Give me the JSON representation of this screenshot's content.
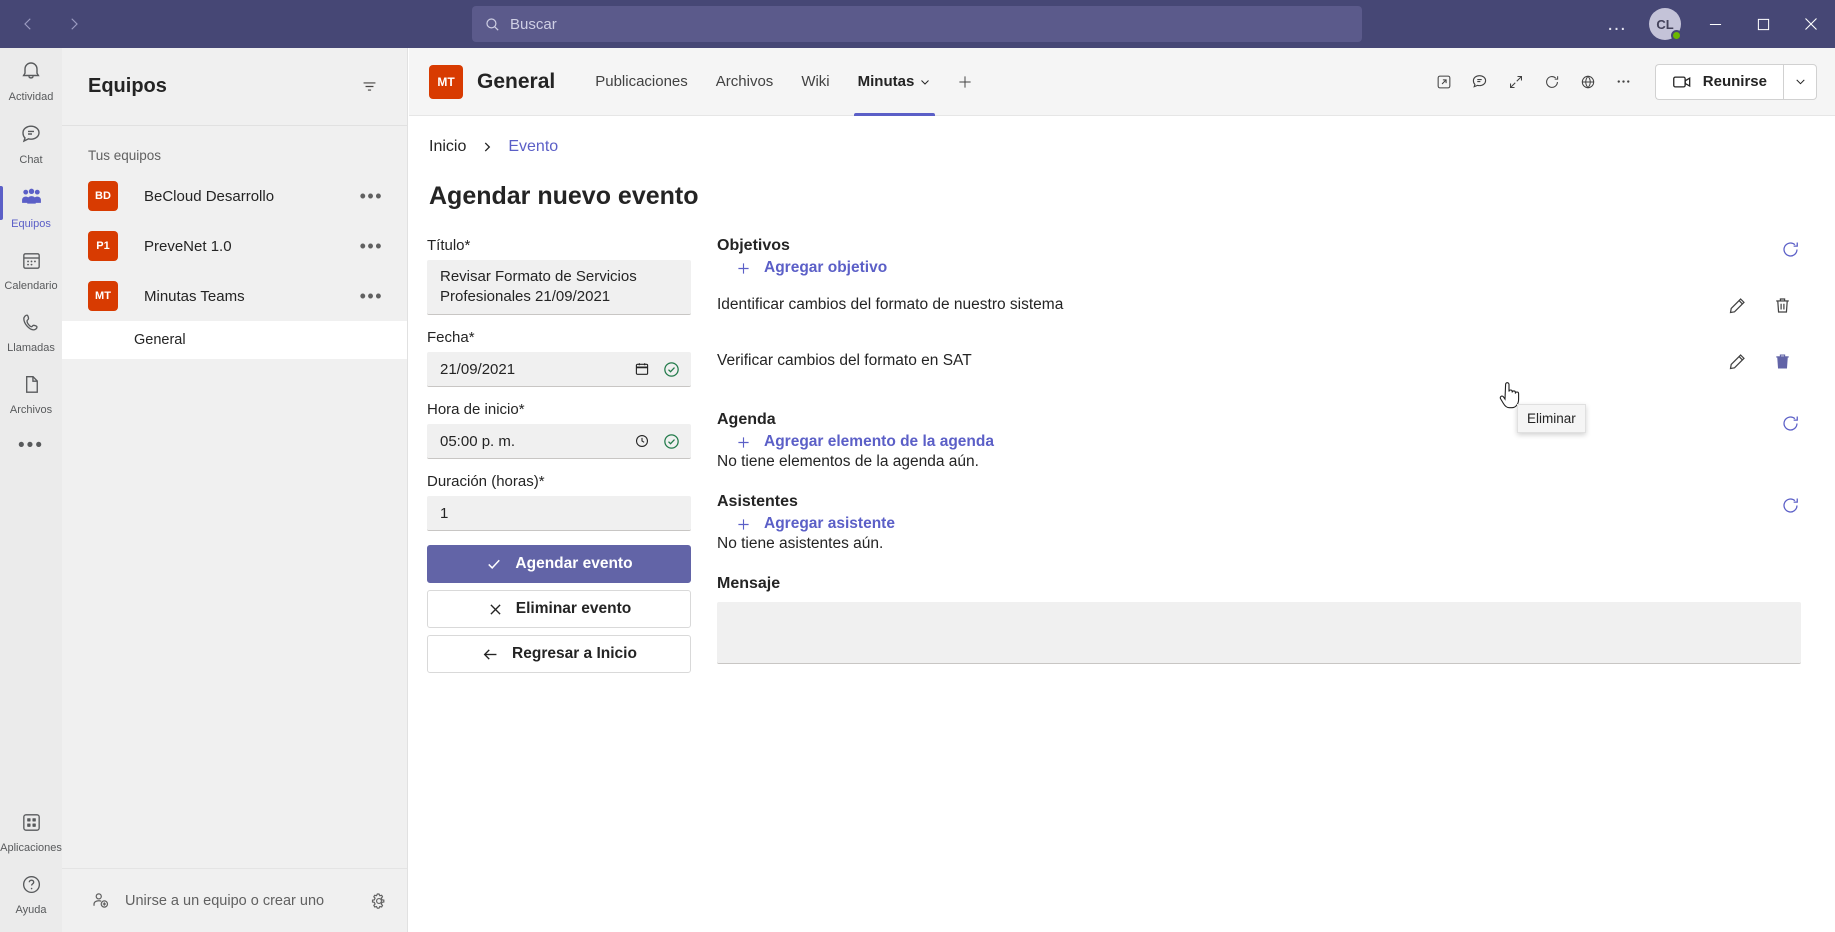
{
  "titlebar": {
    "back_icon": "chevron-left-icon",
    "forward_icon": "chevron-right-icon",
    "search_placeholder": "Buscar",
    "search_icon": "search-icon",
    "more_label": "…",
    "avatar_initials": "CL",
    "minimize_label": "—",
    "maximize_label": "▢",
    "close_label": "✕"
  },
  "rail": {
    "items": [
      {
        "label": "Actividad",
        "icon": "bell-icon",
        "active": false
      },
      {
        "label": "Chat",
        "icon": "chat-icon",
        "active": false
      },
      {
        "label": "Equipos",
        "icon": "people-icon",
        "active": true
      },
      {
        "label": "Calendario",
        "icon": "calendar-icon",
        "active": false
      },
      {
        "label": "Llamadas",
        "icon": "phone-icon",
        "active": false
      },
      {
        "label": "Archivos",
        "icon": "file-icon",
        "active": false
      }
    ],
    "more_label": "•••",
    "bottom": [
      {
        "label": "Aplicaciones",
        "icon": "apps-icon"
      },
      {
        "label": "Ayuda",
        "icon": "help-icon"
      }
    ]
  },
  "teams_panel": {
    "title": "Equipos",
    "filter_icon": "filter-icon",
    "section_label": "Tus equipos",
    "teams": [
      {
        "initials": "BD",
        "name": "BeCloud Desarrollo",
        "more": "•••",
        "color": "#d83b01"
      },
      {
        "initials": "P1",
        "name": "PreveNet 1.0",
        "more": "•••",
        "color": "#d83b01"
      },
      {
        "initials": "MT",
        "name": "Minutas Teams",
        "more": "•••",
        "color": "#d83b01"
      }
    ],
    "channels": [
      {
        "name": "General",
        "active": true
      }
    ],
    "footer": {
      "join_label": "Unirse a un equipo o crear uno",
      "join_icon": "add-people-icon",
      "gear_icon": "gear-icon"
    }
  },
  "channel_header": {
    "team_initials": "MT",
    "channel_name": "General",
    "tabs": [
      {
        "label": "Publicaciones",
        "active": false,
        "has_caret": false
      },
      {
        "label": "Archivos",
        "active": false,
        "has_caret": false
      },
      {
        "label": "Wiki",
        "active": false,
        "has_caret": false
      },
      {
        "label": "Minutas",
        "active": true,
        "has_caret": true
      }
    ],
    "add_tab_icon": "plus-icon",
    "actions": [
      {
        "icon": "open-in-new-icon"
      },
      {
        "icon": "chat-bubble-icon"
      },
      {
        "icon": "expand-diagonal-icon"
      },
      {
        "icon": "refresh-icon"
      },
      {
        "icon": "globe-icon"
      },
      {
        "icon": "more-horizontal-icon"
      }
    ],
    "meet_label": "Reunirse",
    "meet_icon": "video-camera-icon",
    "meet_caret_icon": "chevron-down-icon"
  },
  "breadcrumb": {
    "home": "Inicio",
    "separator_icon": "chevron-right-icon",
    "current": "Evento"
  },
  "page": {
    "title": "Agendar nuevo evento"
  },
  "form": {
    "fields": [
      {
        "label": "Título*",
        "value": "Revisar Formato de Servicios Profesionales 21/09/2021",
        "icon": "",
        "valid_icon": ""
      },
      {
        "label": "Fecha*",
        "value": "21/09/2021",
        "icon": "calendar-icon",
        "valid_icon": "check-circle-icon"
      },
      {
        "label": "Hora de inicio*",
        "value": "05:00 p. m.",
        "icon": "clock-icon",
        "valid_icon": "check-circle-icon"
      },
      {
        "label": "Duración (horas)*",
        "value": "1",
        "icon": "",
        "valid_icon": ""
      }
    ],
    "buttons": [
      {
        "label": "Agendar evento",
        "icon": "check-icon",
        "style": "primary"
      },
      {
        "label": "Eliminar evento",
        "icon": "close-x-icon",
        "style": "secondary"
      },
      {
        "label": "Regresar a Inicio",
        "icon": "arrow-left-icon",
        "style": "secondary"
      }
    ]
  },
  "detail": {
    "objectives": {
      "title": "Objetivos",
      "add_label": "Agregar objetivo",
      "add_icon": "plus-icon",
      "refresh_icon": "refresh-circle-icon",
      "items": [
        {
          "text": "Identificar cambios del formato de nuestro sistema",
          "edit_icon": "pencil-icon",
          "delete_icon": "trash-icon",
          "delete_hot": false
        },
        {
          "text": "Verificar cambios del formato en SAT",
          "edit_icon": "pencil-icon",
          "delete_icon": "trash-icon",
          "delete_hot": true
        }
      ]
    },
    "agenda": {
      "title": "Agenda",
      "add_label": "Agregar elemento de la agenda",
      "add_icon": "plus-icon",
      "refresh_icon": "refresh-circle-icon",
      "empty": "No tiene elementos de la agenda aún."
    },
    "attendees": {
      "title": "Asistentes",
      "add_label": "Agregar asistente",
      "add_icon": "plus-icon",
      "refresh_icon": "refresh-circle-icon",
      "empty": "No tiene asistentes aún."
    },
    "message": {
      "title": "Mensaje",
      "value": ""
    }
  },
  "tooltip": {
    "text": "Eliminar"
  },
  "colors": {
    "brand_purple": "#6264a7",
    "titlebar": "#464775",
    "accent_link": "#5b5fc7",
    "team_avatar": "#d83b01",
    "success_green": "#237b4b"
  }
}
